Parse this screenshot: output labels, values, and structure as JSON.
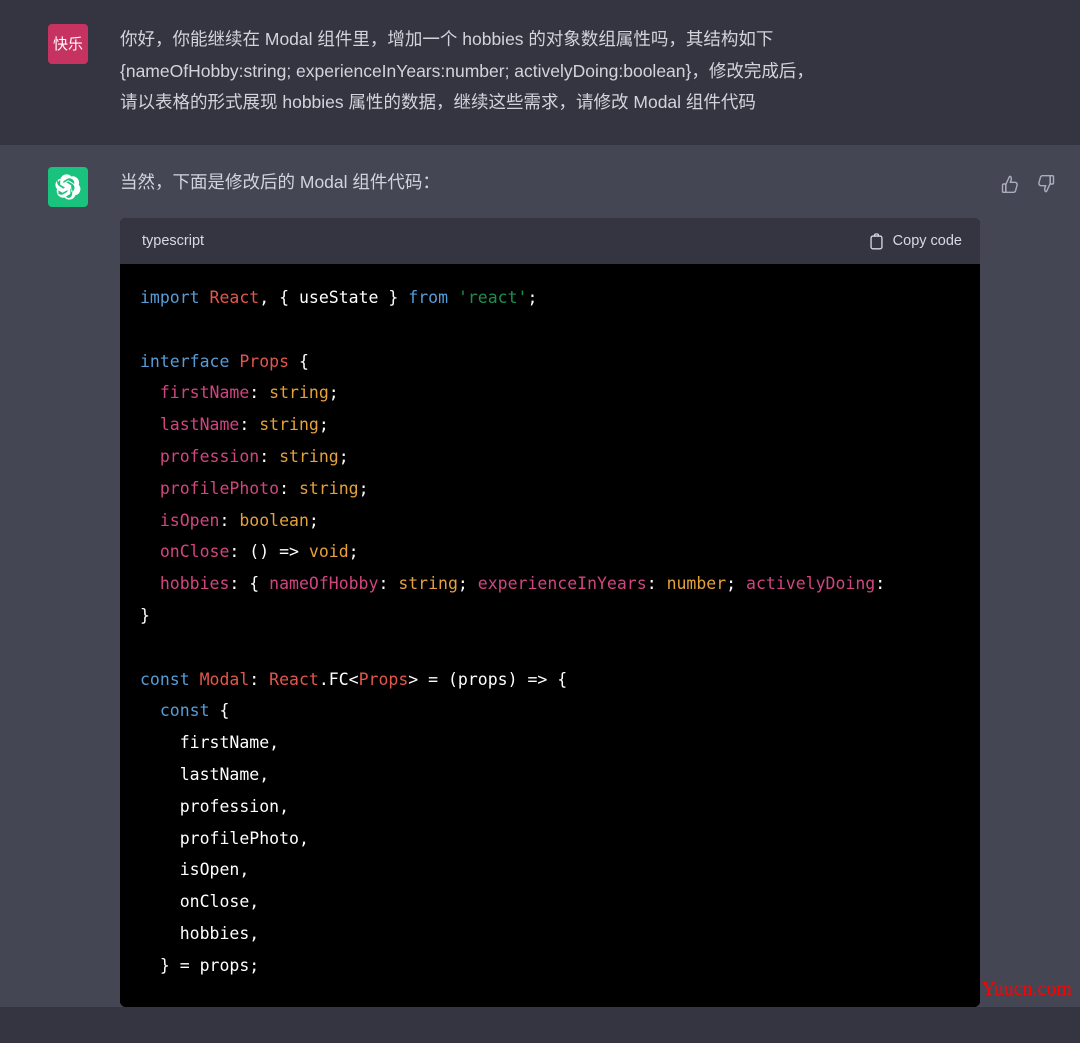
{
  "user_message": {
    "avatar_label": "快乐",
    "avatar_color": "#c73361",
    "text": "你好，你能继续在 Modal 组件里，增加一个 hobbies 的对象数组属性吗，其结构如下\n{nameOfHobby:string; experienceInYears:number; activelyDoing:boolean}，修改完成后，\n请以表格的形式展现 hobbies 属性的数据，继续这些需求，请修改 Modal 组件代码"
  },
  "assistant_message": {
    "avatar_icon": "openai-logo-icon",
    "avatar_color": "#19c37d",
    "text": "当然，下面是修改后的 Modal 组件代码：",
    "feedback": {
      "thumbs_up": "thumbs-up-icon",
      "thumbs_down": "thumbs-down-icon"
    },
    "code_block": {
      "language": "typescript",
      "copy_label": "Copy code",
      "copy_icon": "clipboard-icon",
      "lines": [
        [
          [
            "import ",
            "t-kw"
          ],
          [
            "React",
            "t-type"
          ],
          [
            ", { ",
            "t-pun"
          ],
          [
            "useState",
            "t-plain"
          ],
          [
            " } ",
            "t-pun"
          ],
          [
            "from ",
            "t-kw"
          ],
          [
            "'react'",
            "t-str"
          ],
          [
            ";",
            "t-pun"
          ]
        ],
        [
          [
            "",
            "t-plain"
          ]
        ],
        [
          [
            "interface ",
            "t-kw"
          ],
          [
            "Props",
            "t-type"
          ],
          [
            " {",
            "t-pun"
          ]
        ],
        [
          [
            "  firstName",
            "t-prop"
          ],
          [
            ": ",
            "t-pun"
          ],
          [
            "string",
            "t-prim"
          ],
          [
            ";",
            "t-pun"
          ]
        ],
        [
          [
            "  lastName",
            "t-prop"
          ],
          [
            ": ",
            "t-pun"
          ],
          [
            "string",
            "t-prim"
          ],
          [
            ";",
            "t-pun"
          ]
        ],
        [
          [
            "  profession",
            "t-prop"
          ],
          [
            ": ",
            "t-pun"
          ],
          [
            "string",
            "t-prim"
          ],
          [
            ";",
            "t-pun"
          ]
        ],
        [
          [
            "  profilePhoto",
            "t-prop"
          ],
          [
            ": ",
            "t-pun"
          ],
          [
            "string",
            "t-prim"
          ],
          [
            ";",
            "t-pun"
          ]
        ],
        [
          [
            "  isOpen",
            "t-prop"
          ],
          [
            ": ",
            "t-pun"
          ],
          [
            "boolean",
            "t-prim"
          ],
          [
            ";",
            "t-pun"
          ]
        ],
        [
          [
            "  onClose",
            "t-prop"
          ],
          [
            ": ",
            "t-pun"
          ],
          [
            "() => ",
            "t-pun"
          ],
          [
            "void",
            "t-prim"
          ],
          [
            ";",
            "t-pun"
          ]
        ],
        [
          [
            "  hobbies",
            "t-prop"
          ],
          [
            ": { ",
            "t-pun"
          ],
          [
            "nameOfHobby",
            "t-prop"
          ],
          [
            ": ",
            "t-pun"
          ],
          [
            "string",
            "t-prim"
          ],
          [
            "; ",
            "t-pun"
          ],
          [
            "experienceInYears",
            "t-prop"
          ],
          [
            ": ",
            "t-pun"
          ],
          [
            "number",
            "t-prim"
          ],
          [
            "; ",
            "t-pun"
          ],
          [
            "activelyDoing",
            "t-prop"
          ],
          [
            ":",
            "t-pun"
          ]
        ],
        [
          [
            "}",
            "t-pun"
          ]
        ],
        [
          [
            "",
            "t-plain"
          ]
        ],
        [
          [
            "const ",
            "t-kw"
          ],
          [
            "Modal",
            "t-type"
          ],
          [
            ": ",
            "t-pun"
          ],
          [
            "React",
            "t-type"
          ],
          [
            ".FC<",
            "t-pun"
          ],
          [
            "Props",
            "t-type"
          ],
          [
            "> = (props) => {",
            "t-pun"
          ]
        ],
        [
          [
            "  const ",
            "t-kw"
          ],
          [
            "{",
            "t-pun"
          ]
        ],
        [
          [
            "    firstName,",
            "t-plain"
          ]
        ],
        [
          [
            "    lastName,",
            "t-plain"
          ]
        ],
        [
          [
            "    profession,",
            "t-plain"
          ]
        ],
        [
          [
            "    profilePhoto,",
            "t-plain"
          ]
        ],
        [
          [
            "    isOpen,",
            "t-plain"
          ]
        ],
        [
          [
            "    onClose,",
            "t-plain"
          ]
        ],
        [
          [
            "    hobbies,",
            "t-plain"
          ]
        ],
        [
          [
            "  } = props;",
            "t-plain"
          ]
        ]
      ]
    }
  },
  "watermark": {
    "text": "Yuucn.com",
    "color": "#ff0000"
  }
}
